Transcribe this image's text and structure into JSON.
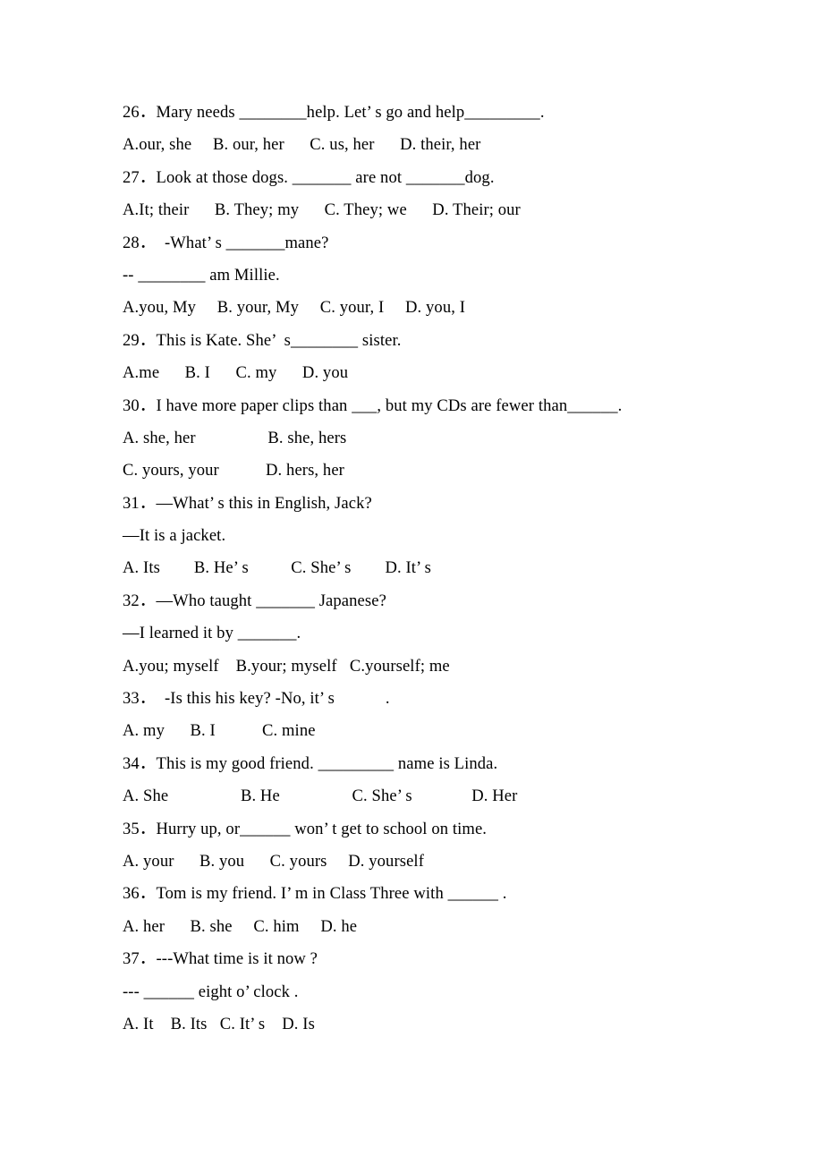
{
  "document": {
    "type": "english-grammar-worksheet",
    "topic": "pronouns-multiple-choice",
    "background_color": "#ffffff",
    "text_color": "#000000"
  },
  "lines": [
    {
      "id": "q26-stem",
      "kind": "question",
      "text": "26．Mary needs ________help. Let’ s go and help_________."
    },
    {
      "id": "q26-opts",
      "kind": "options",
      "text": "A.our, she     B. our, her      C. us, her      D. their, her"
    },
    {
      "id": "q27-stem",
      "kind": "question",
      "text": "27．Look at those dogs. _______ are not _______dog."
    },
    {
      "id": "q27-opts",
      "kind": "options",
      "text": "A.It; their      B. They; my      C. They; we      D. Their; our"
    },
    {
      "id": "q28-stem",
      "kind": "question",
      "text": "28．  ‐What’ s _______mane?"
    },
    {
      "id": "q28-stem2",
      "kind": "question",
      "text": "-- ________ am Millie."
    },
    {
      "id": "q28-opts",
      "kind": "options",
      "text": "A.you, My     B. your, My     C. your, I     D. you, I"
    },
    {
      "id": "q29-stem",
      "kind": "question",
      "text": "29．This is Kate. She’  s________ sister."
    },
    {
      "id": "q29-opts",
      "kind": "options",
      "text": "A.me      B. I      C. my      D. you"
    },
    {
      "id": "q30-stem",
      "kind": "question",
      "text": "30．I have more paper clips than ___, but my CDs are fewer than______."
    },
    {
      "id": "q30-optsAB",
      "kind": "options",
      "text": "A. she, her                 B. she, hers"
    },
    {
      "id": "q30-optsCD",
      "kind": "options",
      "text": "C. yours, your           D. hers, her"
    },
    {
      "id": "q31-stem",
      "kind": "question",
      "text": "31．—What’ s this in English, Jack?"
    },
    {
      "id": "q31-stem2",
      "kind": "question",
      "text": "—It is a jacket."
    },
    {
      "id": "q31-opts",
      "kind": "options",
      "text": "A. Its        B. He’ s          C. She’ s        D. It’ s"
    },
    {
      "id": "q32-stem",
      "kind": "question",
      "text": "32．—Who taught _______ Japanese?"
    },
    {
      "id": "q32-stem2",
      "kind": "question",
      "text": "—I learned it by _______."
    },
    {
      "id": "q32-opts",
      "kind": "options",
      "text": "A.you; myself    B.your; myself   C.yourself; me"
    },
    {
      "id": "q33-stem",
      "kind": "question",
      "text": "33．  ‐Is this his key? -No, it’ s            ."
    },
    {
      "id": "q33-opts",
      "kind": "options",
      "text": "A. my      B. I           C. mine"
    },
    {
      "id": "q34-stem",
      "kind": "question",
      "text": "34．This is my good friend. _________ name is Linda."
    },
    {
      "id": "q34-opts",
      "kind": "options",
      "text": "A. She                 B. He                 C. She’ s              D. Her"
    },
    {
      "id": "q35-stem",
      "kind": "question",
      "text": "35．Hurry up, or______ won’ t get to school on time."
    },
    {
      "id": "q35-opts",
      "kind": "options",
      "text": "A. your      B. you      C. yours     D. yourself"
    },
    {
      "id": "q36-stem",
      "kind": "question",
      "text": "36．Tom is my friend. I’ m in Class Three with ______ ."
    },
    {
      "id": "q36-opts",
      "kind": "options",
      "text": "A. her      B. she     C. him     D. he"
    },
    {
      "id": "q37-stem",
      "kind": "question",
      "text": "37．---What time is it now ?"
    },
    {
      "id": "q37-stem2",
      "kind": "question",
      "text": "--- ______ eight o’ clock ."
    },
    {
      "id": "q37-opts",
      "kind": "options",
      "text": "A. It    B. Its   C. It’ s    D. Is"
    }
  ]
}
